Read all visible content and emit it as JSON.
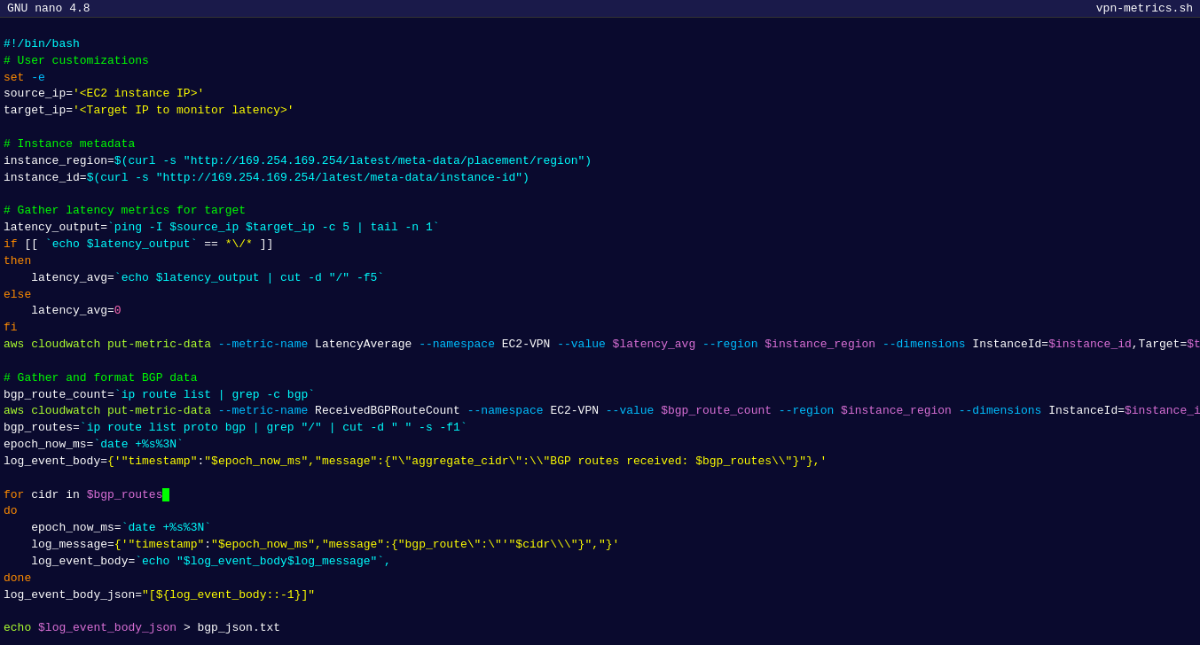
{
  "titleBar": {
    "left": "GNU nano 4.8",
    "right": "vpn-metrics.sh"
  },
  "lines": []
}
